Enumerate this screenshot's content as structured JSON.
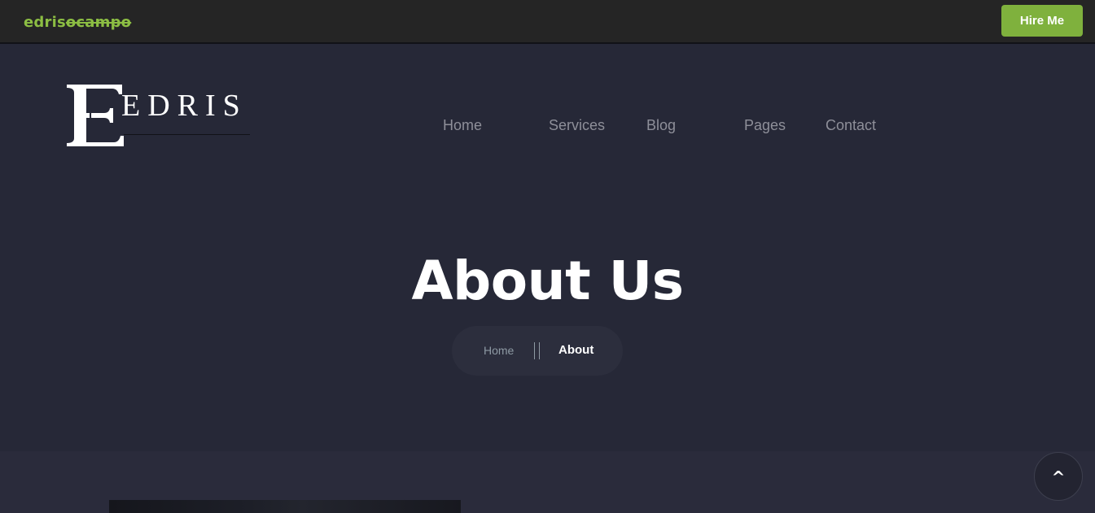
{
  "topbar": {
    "brand_prefix": "edris",
    "brand_suffix": "ocampo",
    "hire_label": "Hire Me"
  },
  "logo": {
    "letter": "E",
    "word": "EDRIS"
  },
  "nav": {
    "items": [
      {
        "label": "Home"
      },
      {
        "label": "Services"
      },
      {
        "label": "Blog"
      },
      {
        "label": "Pages"
      },
      {
        "label": "Contact"
      }
    ]
  },
  "hero": {
    "title": "About Us"
  },
  "breadcrumb": {
    "home": "Home",
    "current": "About"
  },
  "back_to_top": {
    "icon": "chevron-up-icon",
    "glyph": "^"
  },
  "colors": {
    "accent": "#7fb13d",
    "brand_text": "#8cbe43",
    "hero_bg": "#262837",
    "topbar_bg": "#252525"
  }
}
